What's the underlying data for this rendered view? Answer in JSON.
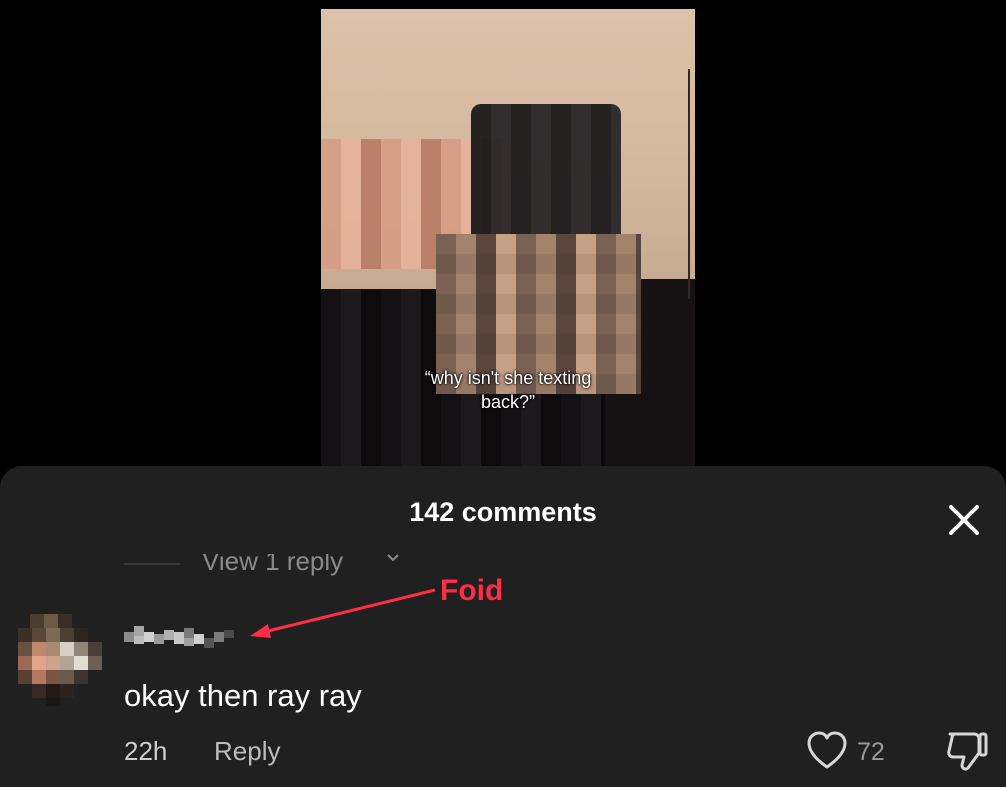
{
  "video": {
    "caption_line1": "“why isn't she texting",
    "caption_line2": "back?”"
  },
  "comments_panel": {
    "title": "142 comments",
    "view_replies_label": "View 1 reply",
    "comment": {
      "text": "okay then ray ray",
      "time": "22h",
      "reply_label": "Reply",
      "like_count": "72"
    }
  },
  "annotation": {
    "label": "Foid",
    "color": "#ff2d45"
  },
  "icons": {
    "close": "close-icon",
    "chevron": "chevron-down-icon",
    "like": "heart-icon",
    "dislike": "thumbs-down-icon"
  }
}
